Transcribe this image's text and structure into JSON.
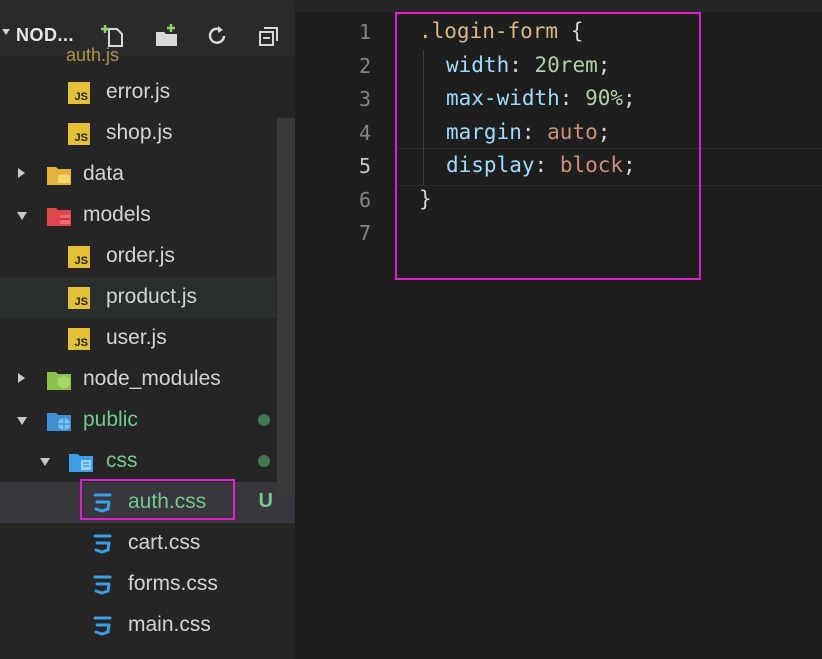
{
  "explorer": {
    "title": "NOD...",
    "partial_item": "auth.js",
    "items": [
      {
        "label": "error.js",
        "type": "js"
      },
      {
        "label": "shop.js",
        "type": "js"
      },
      {
        "label": "data",
        "type": "folder"
      },
      {
        "label": "models",
        "type": "folder-open"
      },
      {
        "label": "order.js",
        "type": "js"
      },
      {
        "label": "product.js",
        "type": "js"
      },
      {
        "label": "user.js",
        "type": "js"
      },
      {
        "label": "node_modules",
        "type": "folder"
      },
      {
        "label": "public",
        "type": "folder-open"
      },
      {
        "label": "css",
        "type": "folder-open"
      },
      {
        "label": "auth.css",
        "type": "css",
        "badge": "U"
      },
      {
        "label": "cart.css",
        "type": "css"
      },
      {
        "label": "forms.css",
        "type": "css"
      },
      {
        "label": "main.css",
        "type": "css"
      }
    ],
    "js_badge": "JS"
  },
  "editor": {
    "line_numbers": [
      "1",
      "2",
      "3",
      "4",
      "5",
      "6",
      "7"
    ],
    "selector": ".login-form",
    "open_brace": " {",
    "close_brace": "}",
    "declarations": [
      {
        "prop": "width",
        "value": "20rem",
        "value_type": "num"
      },
      {
        "prop": "max-width",
        "value": "90%",
        "value_type": "num"
      },
      {
        "prop": "margin",
        "value": "auto",
        "value_type": "kw"
      },
      {
        "prop": "display",
        "value": "block",
        "value_type": "kw"
      }
    ],
    "colon": ": ",
    "semicolon": ";"
  },
  "colors": {
    "highlight": "#e01fcf",
    "untracked": "#73c991",
    "css_icon": "#3b9fe8",
    "js_icon": "#e4c134"
  }
}
